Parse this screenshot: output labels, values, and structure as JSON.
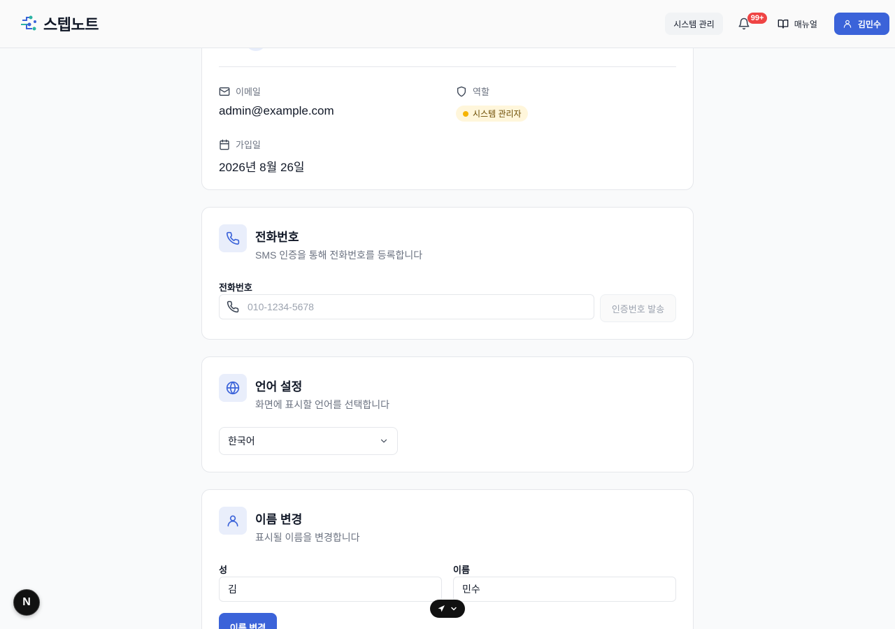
{
  "header": {
    "brand": "스텝노트",
    "system_admin_label": "시스템 관리",
    "notification_badge": "99+",
    "manual_label": "매뉴얼",
    "user_label": "김민수"
  },
  "profile": {
    "email_label": "이메일",
    "email_value": "admin@example.com",
    "role_label": "역할",
    "role_value": "시스템 관리자",
    "joined_label": "가입일",
    "joined_value": "2026년 8월 26일"
  },
  "phone": {
    "title": "전화번호",
    "description": "SMS 인증을 통해 전화번호를 등록합니다",
    "field_label": "전화번호",
    "placeholder": "010-1234-5678",
    "send_button": "인증번호 발송"
  },
  "language": {
    "title": "언어 설정",
    "description": "화면에 표시할 언어를 선택합니다",
    "selected": "한국어"
  },
  "rename": {
    "title": "이름 변경",
    "description": "표시될 이름을 변경합니다",
    "last_name_label": "성",
    "last_name_value": "김",
    "first_name_label": "이름",
    "first_name_value": "민수",
    "submit_button": "이름 변경"
  },
  "dev": {
    "next_badge": "N"
  },
  "colors": {
    "accent": "#3b63d9",
    "danger": "#ef4444",
    "role_bg": "#fff6db"
  }
}
